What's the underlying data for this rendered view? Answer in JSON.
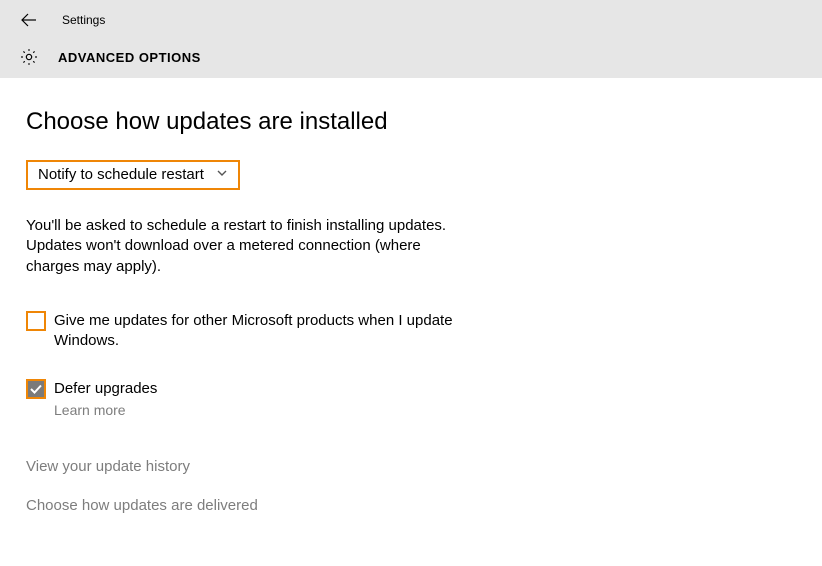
{
  "header": {
    "settings_label": "Settings",
    "section_title": "ADVANCED OPTIONS"
  },
  "page": {
    "title": "Choose how updates are installed",
    "dropdown_value": "Notify to schedule restart",
    "description": "You'll be asked to schedule a restart to finish installing updates. Updates won't download over a metered connection (where charges may apply).",
    "checkbox_other_products": {
      "label": "Give me updates for other Microsoft products when I update Windows.",
      "checked": false
    },
    "checkbox_defer": {
      "label": "Defer upgrades",
      "checked": true,
      "learn_more": "Learn more"
    },
    "link_history": "View your update history",
    "link_delivery": "Choose how updates are delivered"
  },
  "accent_color": "#ef8606"
}
